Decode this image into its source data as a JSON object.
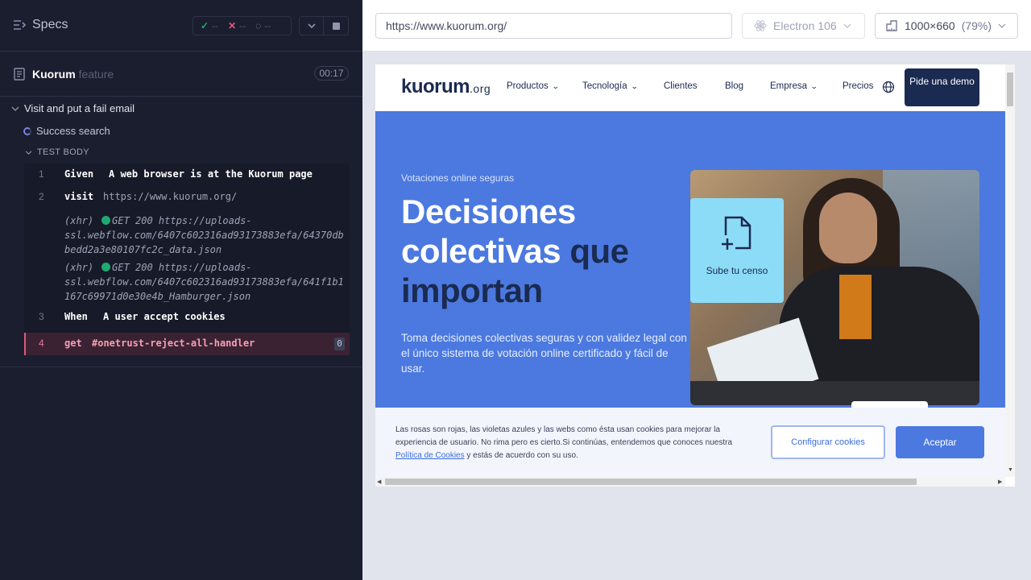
{
  "reporter": {
    "specs_label": "Specs",
    "stats": {
      "passed": "--",
      "failed": "--",
      "pending": "--"
    },
    "spec": {
      "name": "Kuorum",
      "ext": "feature",
      "duration": "00:17"
    },
    "suite_title": "Visit and put a fail email",
    "test_title": "Success search",
    "section_label": "TEST BODY",
    "commands": [
      {
        "num": "1",
        "name": "Given",
        "message": "A web browser is at the Kuorum page"
      },
      {
        "num": "2",
        "name": "visit",
        "message": "https://www.kuorum.org/"
      },
      {
        "num": "3",
        "name": "When",
        "message": "A user accept cookies"
      },
      {
        "num": "4",
        "name": "get",
        "message": "#onetrust-reject-all-handler",
        "count": "0"
      }
    ],
    "xhr": [
      {
        "prefix": "(xhr)",
        "lines": [
          "GET 200 https://uploads-",
          "ssl.webflow.com/6407c602316ad93173883efa/64370db",
          "bedd2a3e80107fc2c_data.json"
        ]
      },
      {
        "prefix": "(xhr)",
        "lines": [
          "GET 200 https://uploads-",
          "ssl.webflow.com/6407c602316ad93173883efa/641f1b1",
          "167c69971d0e30e4b_Hamburger.json"
        ]
      }
    ],
    "colors": {
      "pass": "#1fa971",
      "fail": "#e05a7a",
      "bg": "#1b1e2e"
    }
  },
  "browser": {
    "url": "https://www.kuorum.org/",
    "engine": "Electron 106",
    "viewport": "1000×660",
    "zoom": "(79%)"
  },
  "site": {
    "logo_main": "kuorum",
    "logo_suffix": ".org",
    "nav": [
      "Productos",
      "Tecnología",
      "Clientes",
      "Blog",
      "Empresa",
      "Precios"
    ],
    "cta": "Pide una demo",
    "hero": {
      "eyebrow": "Votaciones online seguras",
      "title_line1": "Decisiones",
      "title_line2a": "colectivas ",
      "title_line2b": "que",
      "title_line3": "importan",
      "lead": "Toma decisiones colectivas seguras y con validez legal con el único sistema de votación online certificado y fácil de usar."
    },
    "upload_card": "Sube tu censo",
    "cookie": {
      "text_before": "Las rosas son rojas, las violetas azules y las webs como ésta usan cookies para mejorar la experiencia de usuario. No rima pero es cierto.Si continúas, entendemos que conoces nuestra ",
      "link": "Política de Cookies",
      "text_after": " y estás de acuerdo con su uso.",
      "configure": "Configurar cookies",
      "accept": "Aceptar"
    },
    "colors": {
      "brand_dark": "#1b2a50",
      "hero_blue": "#4b79e0",
      "card_cyan": "#8ddcf7"
    }
  }
}
